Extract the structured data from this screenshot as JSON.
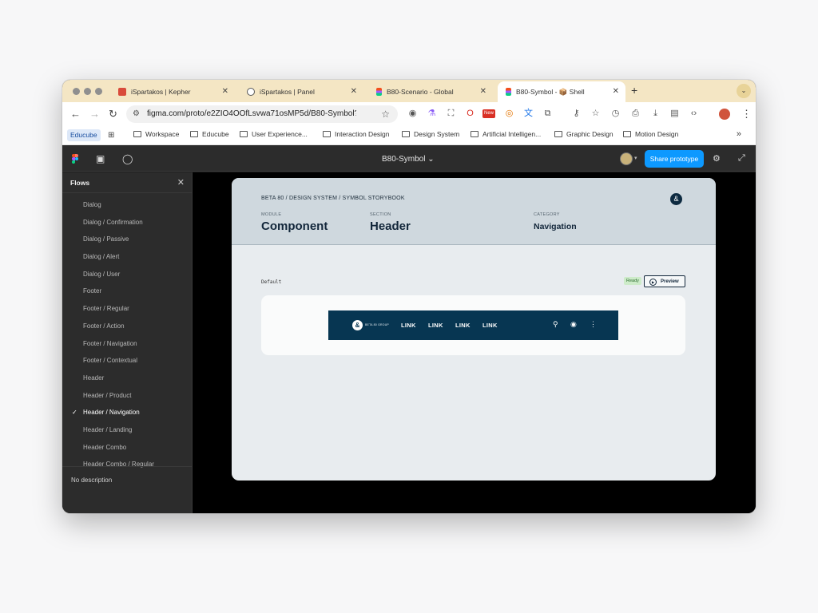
{
  "browser": {
    "tabs": [
      {
        "label": "iSpartakos | Kepher",
        "favicon": "red-box-icon"
      },
      {
        "label": "iSpartakos | Panel",
        "favicon": "globe-icon"
      },
      {
        "label": "B80-Scenario - Global",
        "favicon": "figma-icon"
      },
      {
        "label": "B80-Symbol - 📦 Shell",
        "favicon": "figma-icon",
        "active": true
      }
    ],
    "url": "figma.com/proto/e2ZIO4OOfLsvwa71osMP5d/B80-Symbol?p...",
    "new_badge": "New",
    "bookmarks": {
      "chip": "Educube",
      "folders": [
        "Workspace",
        "Educube",
        "User Experience...",
        "Interaction Design",
        "Design System",
        "Artificial Intelligen...",
        "Graphic Design",
        "Motion Design"
      ]
    }
  },
  "figma": {
    "file_title": "B80-Symbol",
    "share_label": "Share prototype",
    "flows_title": "Flows",
    "flows": [
      "Dialog",
      "Dialog / Confirmation",
      "Dialog / Passive",
      "Dialog / Alert",
      "Dialog / User",
      "Footer",
      "Footer / Regular",
      "Footer / Action",
      "Footer / Navigation",
      "Footer / Contextual",
      "Header",
      "Header / Product",
      "Header / Navigation",
      "Header / Landing",
      "Header Combo",
      "Header Combo / Regular"
    ],
    "selected_flow": "Header / Navigation",
    "description": "No description"
  },
  "frame": {
    "breadcrumb": "BETA 80 / DESIGN SYSTEM / SYMBOL STORYBOOK",
    "module_label": "MODULE",
    "module_value": "Component",
    "section_label": "SECTION",
    "section_value": "Header",
    "category_label": "CATEGORY",
    "category_value": "Navigation",
    "variant": "Default",
    "status": "Ready",
    "preview_label": "Preview",
    "navbar": {
      "brand": "BETA 80 GROUP",
      "links": [
        "LINK",
        "LINK",
        "LINK",
        "LINK"
      ],
      "background": "#073652"
    }
  },
  "colors": {
    "share_button": "#0d99ff",
    "tabstrip": "#f4e6c4",
    "figma_panel": "#2c2c2c"
  }
}
